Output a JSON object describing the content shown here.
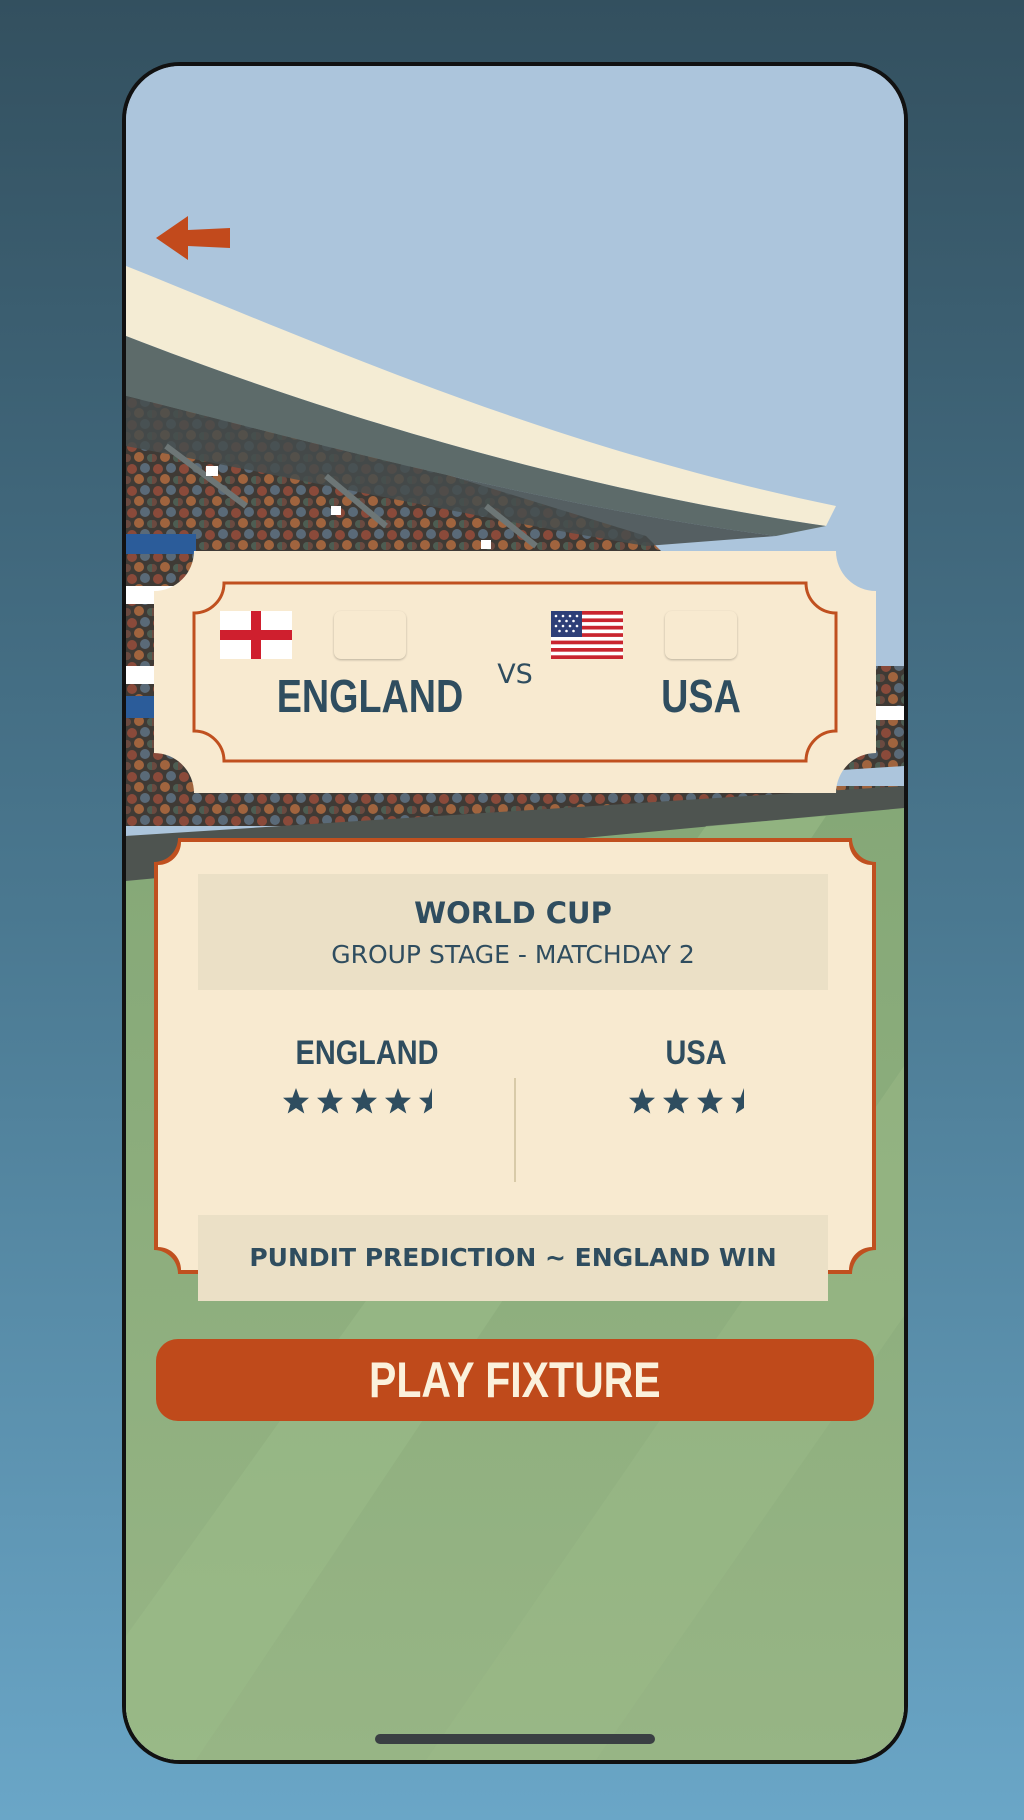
{
  "match": {
    "home": {
      "name": "ENGLAND",
      "flag": "england-flag"
    },
    "away": {
      "name": "USA",
      "flag": "usa-flag"
    },
    "vs_label": "VS"
  },
  "competition": {
    "title": "WORLD CUP",
    "stage": "GROUP STAGE - MATCHDAY 2"
  },
  "ratings": [
    {
      "team": "ENGLAND",
      "stars": 4.5
    },
    {
      "team": "USA",
      "stars": 3.5
    }
  ],
  "prediction": "PUNDIT PREDICTION ~ ENGLAND WIN",
  "buttons": {
    "play": "PLAY FIXTURE",
    "back": "back-arrow-icon"
  },
  "colors": {
    "accent": "#bf4a1b",
    "text": "#2f4d5f",
    "paper": "#f8ead0",
    "pitch": "#8fb07e"
  }
}
